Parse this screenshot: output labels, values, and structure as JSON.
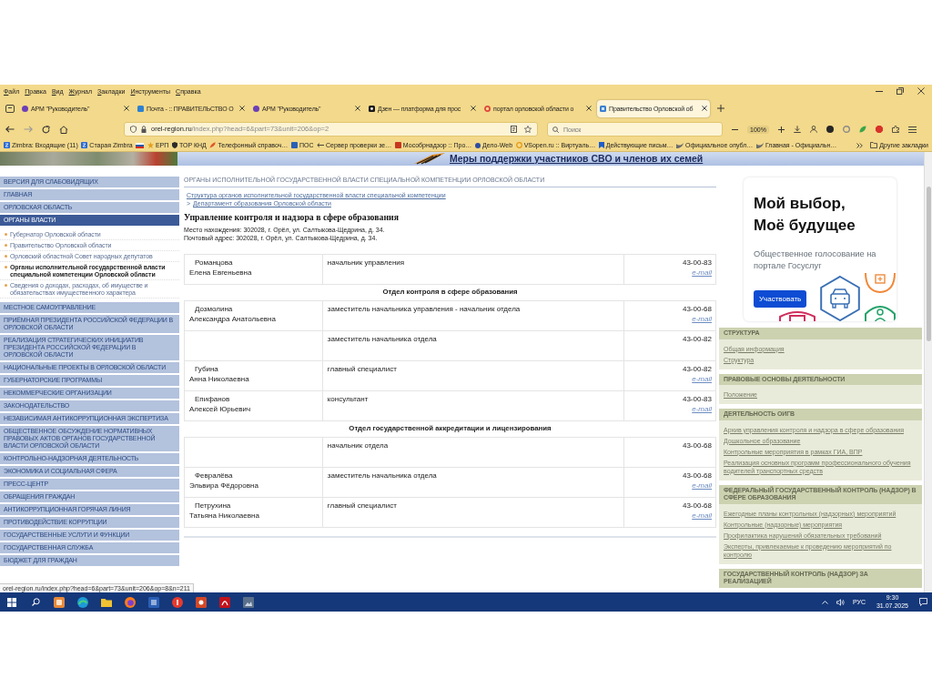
{
  "menu_bar": {
    "items": [
      "Файл",
      "Правка",
      "Вид",
      "Журнал",
      "Закладки",
      "Инструменты",
      "Справка"
    ]
  },
  "tabs": [
    {
      "title": "АРМ \"Руководитель\"",
      "selected": false
    },
    {
      "title": "Почта - :: ПРАВИТЕЛЬСТВО О",
      "selected": false
    },
    {
      "title": "АРМ \"Руководитель\"",
      "selected": false
    },
    {
      "title": "Дзен — платформа для прос",
      "selected": false
    },
    {
      "title": "портал орловской области о",
      "selected": false
    },
    {
      "title": "Правительство Орловской об",
      "selected": true
    }
  ],
  "address_bar": {
    "host": "orel-region.ru",
    "path": "/index.php?head=6&part=73&unit=206&op=2"
  },
  "search": {
    "placeholder": "Поиск"
  },
  "zoom": {
    "reading": "100%"
  },
  "bookmarks": [
    {
      "kind": "link",
      "label": "Zimbra: Входящие (11)"
    },
    {
      "kind": "link",
      "label": "Старая Zimbra"
    },
    {
      "kind": "flag"
    },
    {
      "kind": "link",
      "label": "ЕРП"
    },
    {
      "kind": "link",
      "label": "TOP КНД"
    },
    {
      "kind": "link",
      "label": "Телефонный справоч…"
    },
    {
      "kind": "link",
      "label": "ПОС"
    },
    {
      "kind": "link",
      "label": "Сервер проверки зе…"
    },
    {
      "kind": "link",
      "label": "Мособрнадзор :: Про…"
    },
    {
      "kind": "link",
      "label": "Дело-Web"
    },
    {
      "kind": "link",
      "label": "VSopen.ru :: Виртуаль…"
    },
    {
      "kind": "link",
      "label": "Действующие письм…"
    },
    {
      "kind": "link",
      "label": "Официальное опубл…"
    },
    {
      "kind": "link",
      "label": "Главная - Официальн…"
    }
  ],
  "other_bookmarks": {
    "label": "Другие закладки"
  },
  "page": {
    "banner_title": "Меры поддержки участников СВО и членов их семей",
    "sidebar": [
      {
        "label": "ВЕРСИЯ ДЛЯ СЛАБОВИДЯЩИХ",
        "selected": false
      },
      {
        "label": "ГЛАВНАЯ",
        "selected": false
      },
      {
        "label": "ОРЛОВСКАЯ ОБЛАСТЬ",
        "selected": false
      },
      {
        "label": "ОРГАНЫ ВЛАСТИ",
        "selected": true,
        "children": [
          {
            "label": "Губернатор Орловской области",
            "selected": false
          },
          {
            "label": "Правительство Орловской области",
            "selected": false
          },
          {
            "label": "Орловский областной Совет народных депутатов",
            "selected": false
          },
          {
            "label": "Органы исполнительной государственной власти специальной компетенции Орловской области",
            "selected": true
          },
          {
            "label": "Сведения о доходах, расходах, об имуществе и обязательствах имущественного характера",
            "selected": false
          }
        ]
      },
      {
        "label": "МЕСТНОЕ САМОУПРАВЛЕНИЕ",
        "selected": false
      },
      {
        "label": "ПРИЁМНАЯ ПРЕЗИДЕНТА РОССИЙСКОЙ ФЕДЕРАЦИИ В ОРЛОВСКОЙ ОБЛАСТИ",
        "selected": false
      },
      {
        "label": "РЕАЛИЗАЦИЯ СТРАТЕГИЧЕСКИХ ИНИЦИАТИВ ПРЕЗИДЕНТА РОССИЙСКОЙ ФЕДЕРАЦИИ В ОРЛОВСКОЙ ОБЛАСТИ",
        "selected": false
      },
      {
        "label": "НАЦИОНАЛЬНЫЕ ПРОЕКТЫ В ОРЛОВСКОЙ ОБЛАСТИ",
        "selected": false
      },
      {
        "label": "ГУБЕРНАТОРСКИЕ ПРОГРАММЫ",
        "selected": false
      },
      {
        "label": "НЕКОММЕРЧЕСКИЕ ОРГАНИЗАЦИИ",
        "selected": false
      },
      {
        "label": "ЗАКОНОДАТЕЛЬСТВО",
        "selected": false
      },
      {
        "label": "НЕЗАВИСИМАЯ АНТИКОРРУПЦИОННАЯ ЭКСПЕРТИЗА",
        "selected": false
      },
      {
        "label": "ОБЩЕСТВЕННОЕ ОБСУЖДЕНИЕ НОРМАТИВНЫХ ПРАВОВЫХ АКТОВ ОРГАНОВ ГОСУДАРСТВЕННОЙ ВЛАСТИ ОРЛОВСКОЙ ОБЛАСТИ",
        "selected": false
      },
      {
        "label": "КОНТРОЛЬНО-НАДЗОРНАЯ ДЕЯТЕЛЬНОСТЬ",
        "selected": false
      },
      {
        "label": "ЭКОНОМИКА И СОЦИАЛЬНАЯ СФЕРА",
        "selected": false
      },
      {
        "label": "ПРЕСС-ЦЕНТР",
        "selected": false
      },
      {
        "label": "ОБРАЩЕНИЯ ГРАЖДАН",
        "selected": false
      },
      {
        "label": "АНТИКОРРУПЦИОННАЯ ГОРЯЧАЯ ЛИНИЯ",
        "selected": false
      },
      {
        "label": "ПРОТИВОДЕЙСТВИЕ КОРРУПЦИИ",
        "selected": false
      },
      {
        "label": "ГОСУДАРСТВЕННЫЕ УСЛУГИ И ФУНКЦИИ",
        "selected": false
      },
      {
        "label": "ГОСУДАРСТВЕННАЯ СЛУЖБА",
        "selected": false
      },
      {
        "label": "БЮДЖЕТ ДЛЯ ГРАЖДАН",
        "selected": false
      }
    ],
    "section_title": "ОРГАНЫ ИСПОЛНИТЕЛЬНОЙ ГОСУДАРСТВЕННОЙ ВЛАСТИ СПЕЦИАЛЬНОЙ КОМПЕТЕНЦИИ ОРЛОВСКОЙ ОБЛАСТИ",
    "breadcrumbs": [
      {
        "label": "Структура органов исполнительной государственной власти специальной компетенции"
      },
      {
        "separator": ">",
        "label": "Департамент образования Орловской области"
      }
    ],
    "heading": "Управление контроля и надзора в сфере образования",
    "addresses": [
      "Место нахождения: 302028, г. Орёл, ул. Салтыкова-Щедрина, д. 34.",
      "Почтовый адрес: 302028, г. Орёл, ул. Салтыкова-Щедрина, д. 34."
    ],
    "staff": [
      {
        "kind": "person",
        "surname": "Романцова",
        "given_names": "Елена Евгеньевна",
        "position": "начальник управления",
        "phone": "43-00-83",
        "email": "e-mail"
      },
      {
        "kind": "department",
        "title": "Отдел контроля в сфере образования"
      },
      {
        "kind": "person",
        "surname": "Дозмолина",
        "given_names": "Александра Анатольевна",
        "position": "заместитель начальника управления - начальник отдела",
        "phone": "43-00-68",
        "email": "e-mail"
      },
      {
        "kind": "person",
        "position": "заместитель начальника отдела",
        "phone": "43-00-82"
      },
      {
        "kind": "person",
        "surname": "Губина",
        "given_names": "Анна Николаевна",
        "position": "главный специалист",
        "phone": "43-00-82",
        "email": "e-mail"
      },
      {
        "kind": "person",
        "surname": "Епифанов",
        "given_names": "Алексей Юрьевич",
        "position": "консультант",
        "phone": "43-00-83",
        "email": "e-mail"
      },
      {
        "kind": "department",
        "title": "Отдел государственной аккредитации и лицензирования"
      },
      {
        "kind": "person",
        "position": "начальник отдела",
        "phone": "43-00-68"
      },
      {
        "kind": "person",
        "surname": "Февралёва",
        "given_names": "Эльвира Фёдоровна",
        "position": "заместитель начальника отдела",
        "phone": "43-00-68",
        "email": "e-mail"
      },
      {
        "kind": "person",
        "surname": "Петрухина",
        "given_names": "Татьяна Николаевна",
        "position": "главный специалист",
        "phone": "43-00-68",
        "email": "e-mail"
      }
    ],
    "ad": {
      "title": "Мой выбор, Моё будущее",
      "text": "Общественное голосование на портале Госуслуг",
      "button": "Участвовать"
    },
    "info_sections": [
      {
        "title": "СТРУКТУРА",
        "links": [
          "Общая информация",
          "Структура"
        ]
      },
      {
        "title": "ПРАВОВЫЕ ОСНОВЫ ДЕЯТЕЛЬНОСТИ",
        "links": [
          "Положение"
        ]
      },
      {
        "title": "ДЕЯТЕЛЬНОСТЬ ОИГВ",
        "links": [
          "Архив управления контроля и надзора в сфере образования",
          "Дошкольное образование",
          "Контрольные мероприятия в рамках ГИА, ВПР",
          "Реализация основных программ профессионального обучения водителей транспортных средств"
        ]
      },
      {
        "title": "ФЕДЕРАЛЬНЫЙ ГОСУДАРСТВЕННЫЙ КОНТРОЛЬ (НАДЗОР) В СФЕРЕ ОБРАЗОВАНИЯ",
        "links": [
          "Ежегодные планы контрольных (надзорных) мероприятий",
          "Контрольные (надзорные) мероприятия",
          "Профилактика нарушений обязательных требований",
          "Эксперты, привлекаемые к проведению мероприятий по контролю"
        ]
      },
      {
        "title": "ГОСУДАРСТВЕННЫЙ КОНТРОЛЬ (НАДЗОР) ЗА РЕАЛИЗАЦИЕЙ"
      }
    ]
  },
  "status_url": "orel-region.ru/index.php?head=6&part=73&unit=206&op=8&n=211",
  "taskbar": {
    "language": "РУС",
    "time": "9:30",
    "date": "31.07.2025"
  }
}
